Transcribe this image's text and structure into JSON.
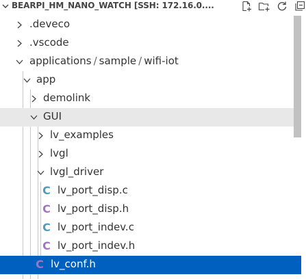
{
  "explorer": {
    "title": "BEARPI_HM_NANO_WATCH [SSH: 172.16.0....",
    "actions": [
      {
        "name": "new-file-icon"
      },
      {
        "name": "new-folder-icon"
      },
      {
        "name": "refresh-icon"
      },
      {
        "name": "collapse-all-icon"
      }
    ]
  },
  "tree": {
    "deveco": ".deveco",
    "vscode": ".vscode",
    "applications_path": {
      "part1": "applications",
      "part2": "sample",
      "part3": "wifi-iot",
      "separator": "/"
    },
    "app": "app",
    "demolink": "demolink",
    "gui": "GUI",
    "lv_examples": "lv_examples",
    "lvgl": "lvgl",
    "lvgl_driver": "lvgl_driver",
    "files": [
      {
        "name": "lv_port_disp.c",
        "icon": "C",
        "color": "#519aba"
      },
      {
        "name": "lv_port_disp.h",
        "icon": "C",
        "color": "#a074c4"
      },
      {
        "name": "lv_port_indev.c",
        "icon": "C",
        "color": "#519aba"
      },
      {
        "name": "lv_port_indev.h",
        "icon": "C",
        "color": "#a074c4"
      }
    ],
    "selected_file": {
      "name": "lv_conf.h",
      "icon": "C",
      "color": "#a074c4"
    }
  },
  "colors": {
    "selection": "#0060c0",
    "active_row": "#e8e8e8",
    "c_file": "#519aba",
    "h_file": "#a074c4"
  }
}
